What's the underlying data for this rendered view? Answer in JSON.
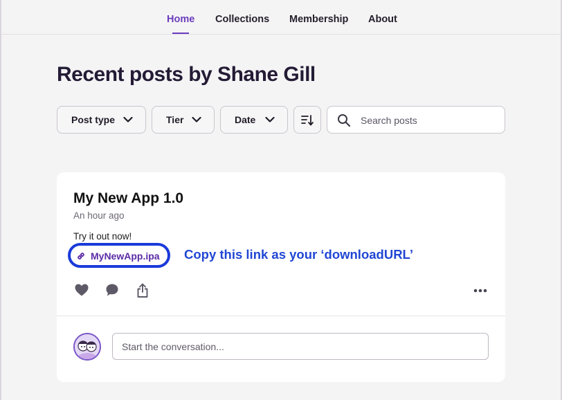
{
  "nav": {
    "items": [
      {
        "label": "Home",
        "active": true
      },
      {
        "label": "Collections",
        "active": false
      },
      {
        "label": "Membership",
        "active": false
      },
      {
        "label": "About",
        "active": false
      }
    ]
  },
  "page": {
    "title": "Recent posts by Shane Gill"
  },
  "filters": {
    "post_type": "Post type",
    "tier": "Tier",
    "date": "Date",
    "search_placeholder": "Search posts"
  },
  "post": {
    "title": "My New App 1.0",
    "time": "An hour ago",
    "body": "Try it out now!",
    "attachment": "MyNewApp.ipa",
    "annotation": "Copy this link as your ‘downloadURL’",
    "comment_placeholder": "Start the conversation..."
  },
  "colors": {
    "accent": "#6a3bbd",
    "annotation": "#2146d4",
    "highlight_outline": "#1a3ad9"
  },
  "icons": [
    "chevron-down-icon",
    "sort-icon",
    "search-icon",
    "link-icon",
    "heart-icon",
    "comment-icon",
    "share-icon",
    "more-icon",
    "avatar"
  ]
}
